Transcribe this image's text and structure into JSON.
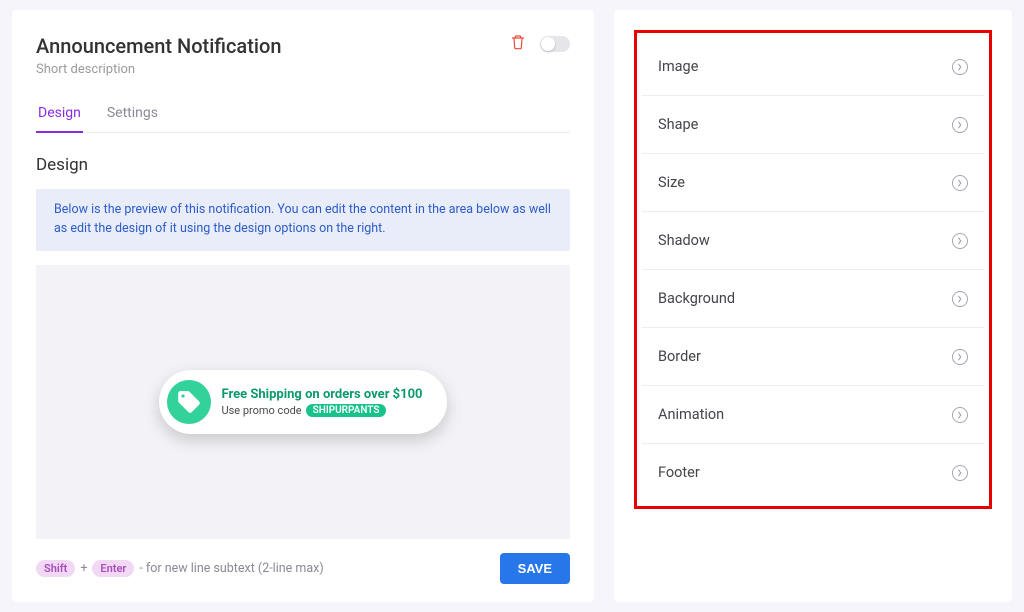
{
  "header": {
    "title": "Announcement Notification",
    "subtitle": "Short description"
  },
  "tabs": [
    {
      "label": "Design",
      "active": true
    },
    {
      "label": "Settings",
      "active": false
    }
  ],
  "section_title": "Design",
  "info_text": "Below is the preview of this notification. You can edit the content in the area below as well as edit the design of it using the design options on the right.",
  "preview_notification": {
    "headline": "Free Shipping on orders over $100",
    "subline_prefix": "Use promo code",
    "promo_code": "SHIPURPANTS"
  },
  "hint": {
    "key1": "Shift",
    "plus": "+",
    "key2": "Enter",
    "text": "- for new line subtext (2-line max)"
  },
  "save_label": "SAVE",
  "design_options": [
    {
      "label": "Image"
    },
    {
      "label": "Shape"
    },
    {
      "label": "Size"
    },
    {
      "label": "Shadow"
    },
    {
      "label": "Background"
    },
    {
      "label": "Border"
    },
    {
      "label": "Animation"
    },
    {
      "label": "Footer"
    }
  ]
}
